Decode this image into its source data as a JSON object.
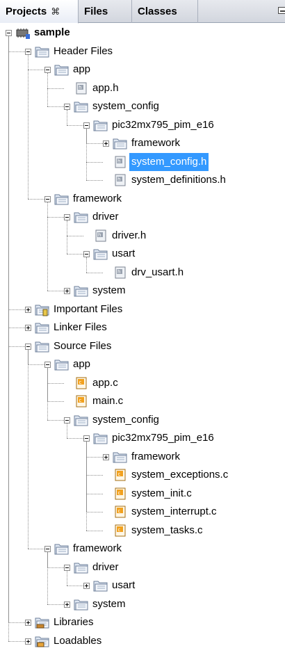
{
  "tabs": [
    {
      "label": "Projects",
      "close": "⌘"
    },
    {
      "label": "Files"
    },
    {
      "label": "Classes"
    }
  ],
  "tree": [
    {
      "label": "sample",
      "icon": "project-chip-icon",
      "bold": true,
      "expanded": true
    },
    {
      "label": "Header Files",
      "icon": "folder-icon",
      "expanded": true
    },
    {
      "label": "app",
      "icon": "folder-icon",
      "expanded": true
    },
    {
      "label": "app.h",
      "icon": "header-file-icon"
    },
    {
      "label": "system_config",
      "icon": "folder-icon",
      "expanded": true
    },
    {
      "label": "pic32mx795_pim_e16",
      "icon": "folder-icon",
      "expanded": true
    },
    {
      "label": "framework",
      "icon": "folder-icon",
      "expanded": false
    },
    {
      "label": "system_config.h",
      "icon": "header-file-icon",
      "selected": true
    },
    {
      "label": "system_definitions.h",
      "icon": "header-file-icon"
    },
    {
      "label": "framework",
      "icon": "folder-icon",
      "expanded": true
    },
    {
      "label": "driver",
      "icon": "folder-icon",
      "expanded": true
    },
    {
      "label": "driver.h",
      "icon": "header-file-icon"
    },
    {
      "label": "usart",
      "icon": "folder-icon",
      "expanded": true
    },
    {
      "label": "drv_usart.h",
      "icon": "header-file-icon"
    },
    {
      "label": "system",
      "icon": "folder-icon",
      "expanded": false
    },
    {
      "label": "Important Files",
      "icon": "important-folder-icon",
      "expanded": false
    },
    {
      "label": "Linker Files",
      "icon": "folder-icon",
      "expanded": false
    },
    {
      "label": "Source Files",
      "icon": "folder-icon",
      "expanded": true
    },
    {
      "label": "app",
      "icon": "folder-icon",
      "expanded": true
    },
    {
      "label": "app.c",
      "icon": "source-file-icon"
    },
    {
      "label": "main.c",
      "icon": "source-file-icon"
    },
    {
      "label": "system_config",
      "icon": "folder-icon",
      "expanded": true
    },
    {
      "label": "pic32mx795_pim_e16",
      "icon": "folder-icon",
      "expanded": true
    },
    {
      "label": "framework",
      "icon": "folder-icon",
      "expanded": false
    },
    {
      "label": "system_exceptions.c",
      "icon": "source-file-icon"
    },
    {
      "label": "system_init.c",
      "icon": "source-file-icon"
    },
    {
      "label": "system_interrupt.c",
      "icon": "source-file-icon"
    },
    {
      "label": "system_tasks.c",
      "icon": "source-file-icon"
    },
    {
      "label": "framework",
      "icon": "folder-icon",
      "expanded": true
    },
    {
      "label": "driver",
      "icon": "folder-icon",
      "expanded": true
    },
    {
      "label": "usart",
      "icon": "folder-icon",
      "expanded": false
    },
    {
      "label": "system",
      "icon": "folder-icon",
      "expanded": false
    },
    {
      "label": "Libraries",
      "icon": "library-folder-icon",
      "expanded": false
    },
    {
      "label": "Loadables",
      "icon": "loadables-folder-icon",
      "expanded": false
    }
  ]
}
